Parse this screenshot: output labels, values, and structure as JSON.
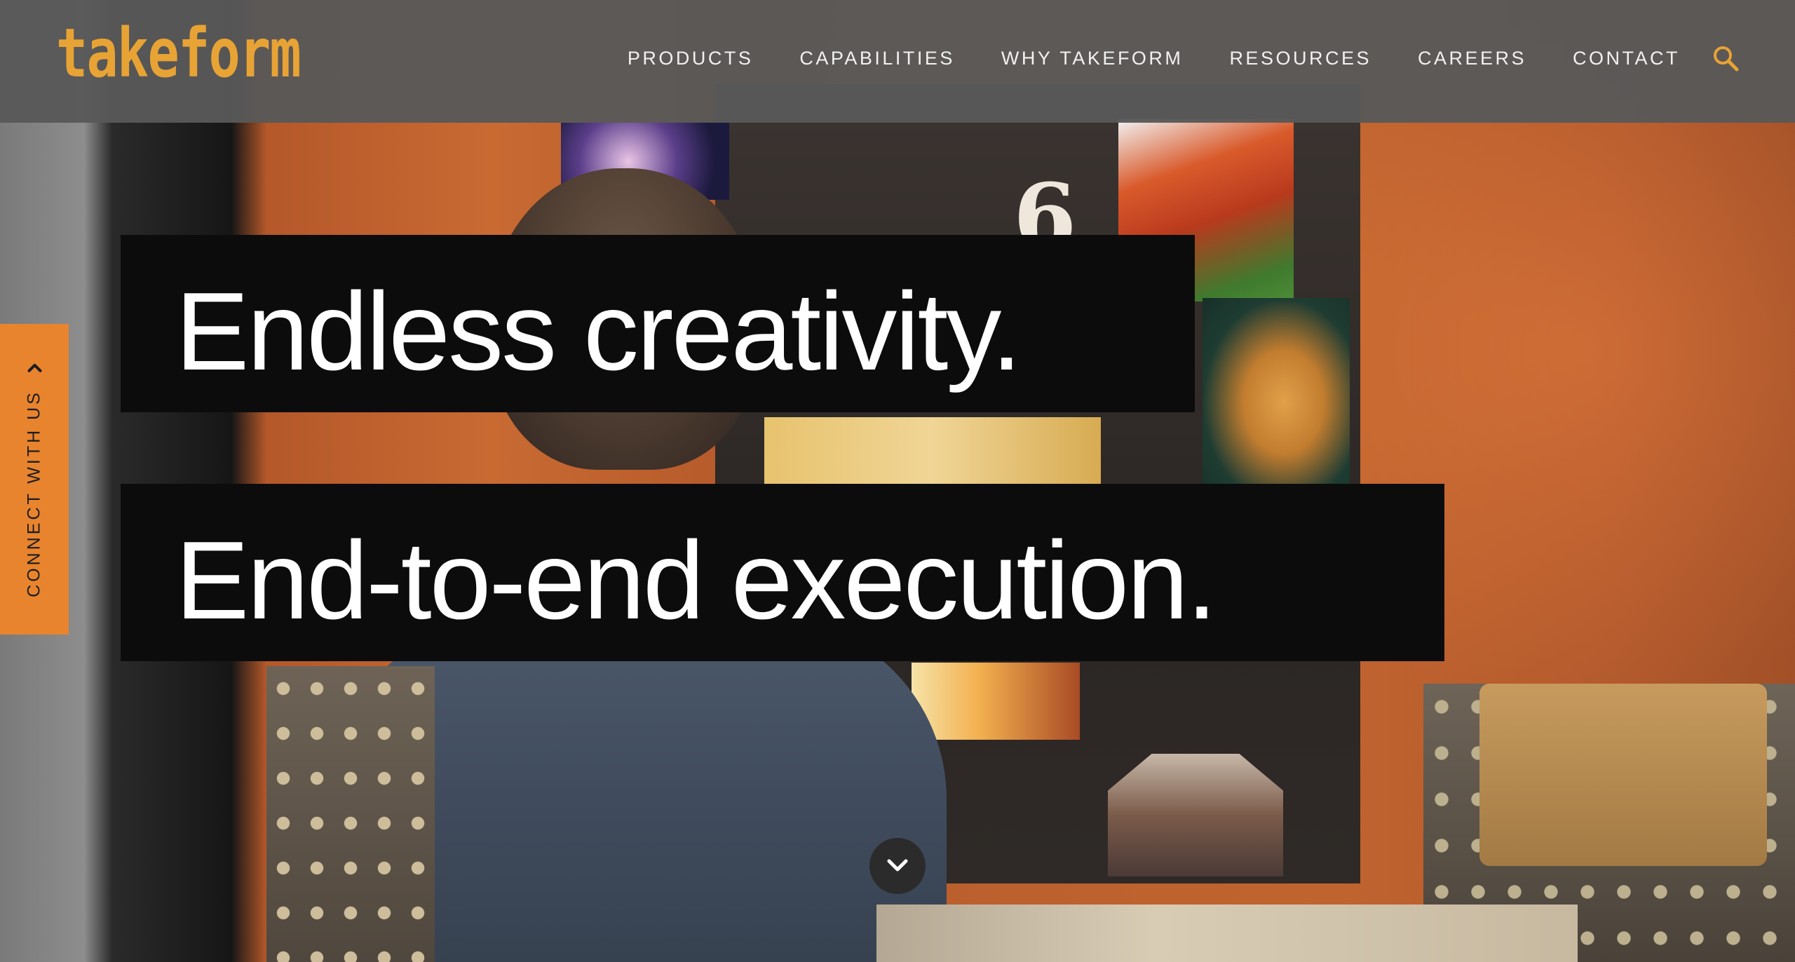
{
  "brand": {
    "logo_text": "takeform",
    "accent_color": "#e8a335"
  },
  "nav": {
    "items": [
      {
        "label": "PRODUCTS"
      },
      {
        "label": "CAPABILITIES"
      },
      {
        "label": "WHY TAKEFORM"
      },
      {
        "label": "RESOURCES"
      },
      {
        "label": "CAREERS"
      },
      {
        "label": "CONTACT"
      }
    ],
    "search_icon": "search-icon"
  },
  "hero": {
    "headline_line_1": "Endless creativity.",
    "headline_line_2": "End-to-end execution.",
    "scroll_icon": "chevron-down-icon"
  },
  "side_tab": {
    "label": "CONNECT WITH US",
    "icon": "chevron-right-icon",
    "color": "#e8842e"
  }
}
